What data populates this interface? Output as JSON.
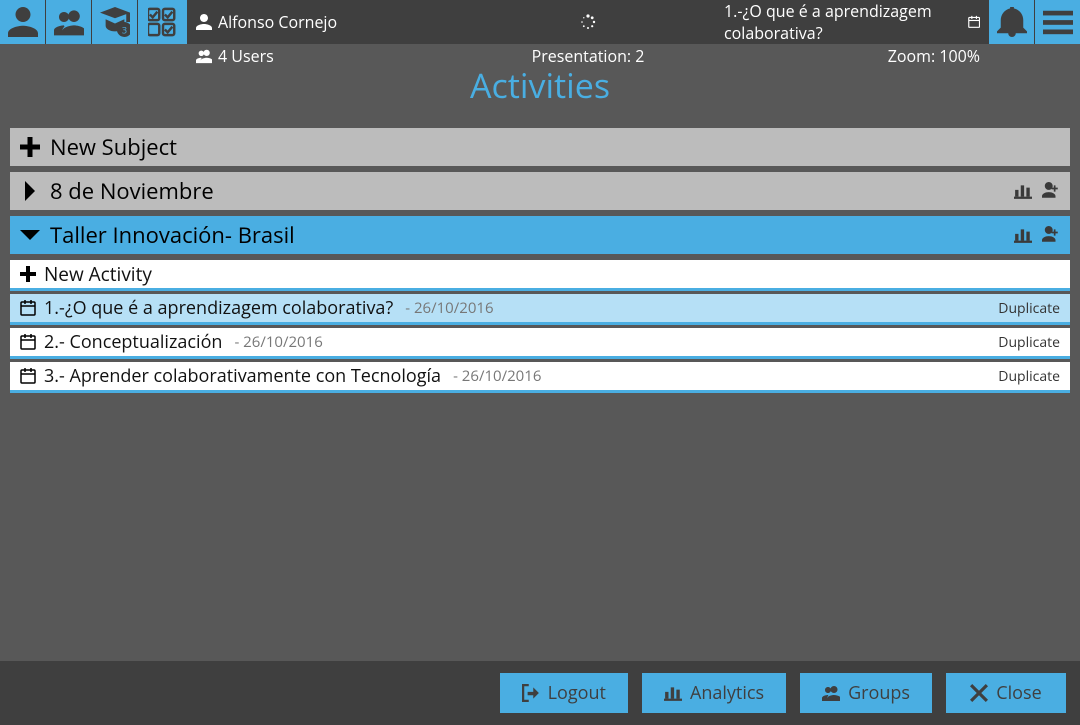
{
  "header": {
    "user_name": "Alfonso Cornejo",
    "current_activity": "1.-¿O que é a aprendizagem colaborativa?",
    "users_count_label": "4 Users",
    "presentation_label": "Presentation: 2",
    "zoom_label": "Zoom: 100%"
  },
  "page_title": "Activities",
  "subjects": {
    "new_subject_label": "New Subject",
    "items": [
      {
        "name": "8 de Noviembre",
        "open": false
      },
      {
        "name": "Taller Innovación- Brasil",
        "open": true
      }
    ]
  },
  "activities": {
    "new_activity_label": "New Activity",
    "rows": [
      {
        "title": "1.-¿O que é a aprendizagem colaborativa?",
        "date": "- 26/10/2016",
        "dup": "Duplicate",
        "selected": true
      },
      {
        "title": "2.- Conceptualización",
        "date": "- 26/10/2016",
        "dup": "Duplicate",
        "selected": false
      },
      {
        "title": "3.- Aprender colaborativamente con Tecnología",
        "date": "- 26/10/2016",
        "dup": "Duplicate",
        "selected": false
      }
    ]
  },
  "footer": {
    "logout": "Logout",
    "analytics": "Analytics",
    "groups": "Groups",
    "close": "Close"
  }
}
